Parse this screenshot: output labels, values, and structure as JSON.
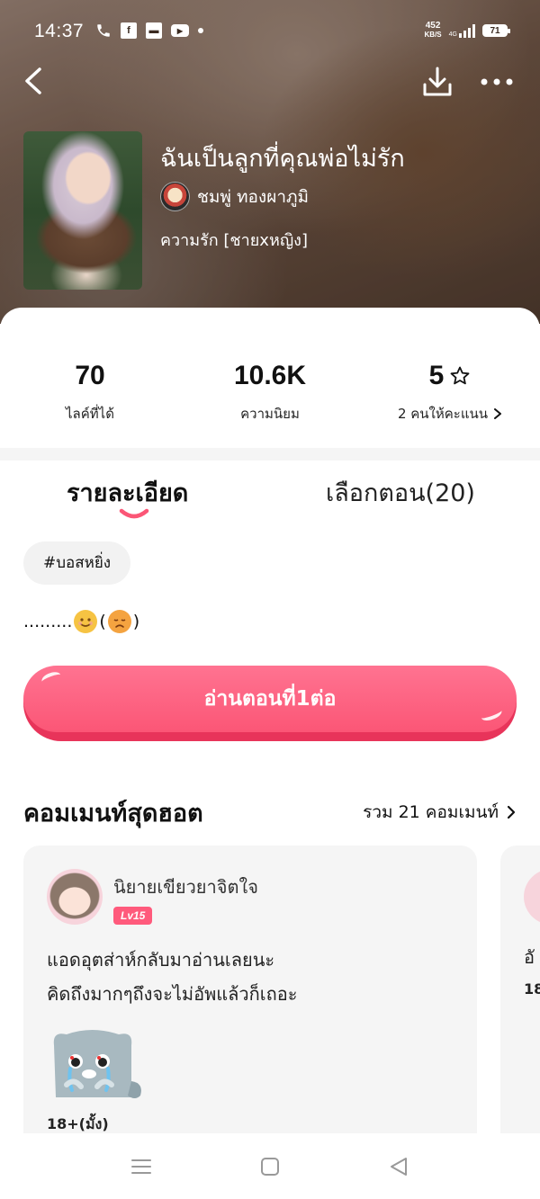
{
  "status_bar": {
    "time": "14:37",
    "net_speed_value": "452",
    "net_speed_unit": "KB/S",
    "network_type": "4G",
    "battery": "71"
  },
  "book": {
    "title": "ฉันเป็นลูกที่คุณพ่อไม่รัก",
    "author": "ชมพู่ ทองผาภูมิ",
    "genre": "ความรัก [ชายxหญิง]"
  },
  "stats": [
    {
      "value": "70",
      "label": "ไลค์ที่ได้"
    },
    {
      "value": "10.6K",
      "label": "ความนิยม"
    },
    {
      "value": "5",
      "label": "2 คนให้คะแนน"
    }
  ],
  "tabs": {
    "details": "รายละเอียด",
    "episodes": "เลือกตอน(20)"
  },
  "tag": "#บอสหยิ่ง",
  "synopsis": {
    "prefix": ".........",
    "middle": " (",
    "suffix": ")"
  },
  "read_button": "อ่านตอนที่1ต่อ",
  "hot_comments": {
    "title": "คอมเมนท์สุดฮอต",
    "total": "รวม 21 คอมเมนท์"
  },
  "comments": [
    {
      "user": "นิยายเขียวยาจิตใจ",
      "level": "Lv15",
      "lines": [
        "แอดอุตส่าห์กลับมาอ่านเลยนะ",
        "คิดถึงมากๆถึงจะไม่อัพแล้วก็เถอะ"
      ],
      "rating": "18+(มั้ง)"
    },
    {
      "text": "อั",
      "rating": "18"
    }
  ],
  "colors": {
    "accent": "#fb5676",
    "accent_dark": "#e8345a",
    "level_badge": "#ff5a7c"
  }
}
